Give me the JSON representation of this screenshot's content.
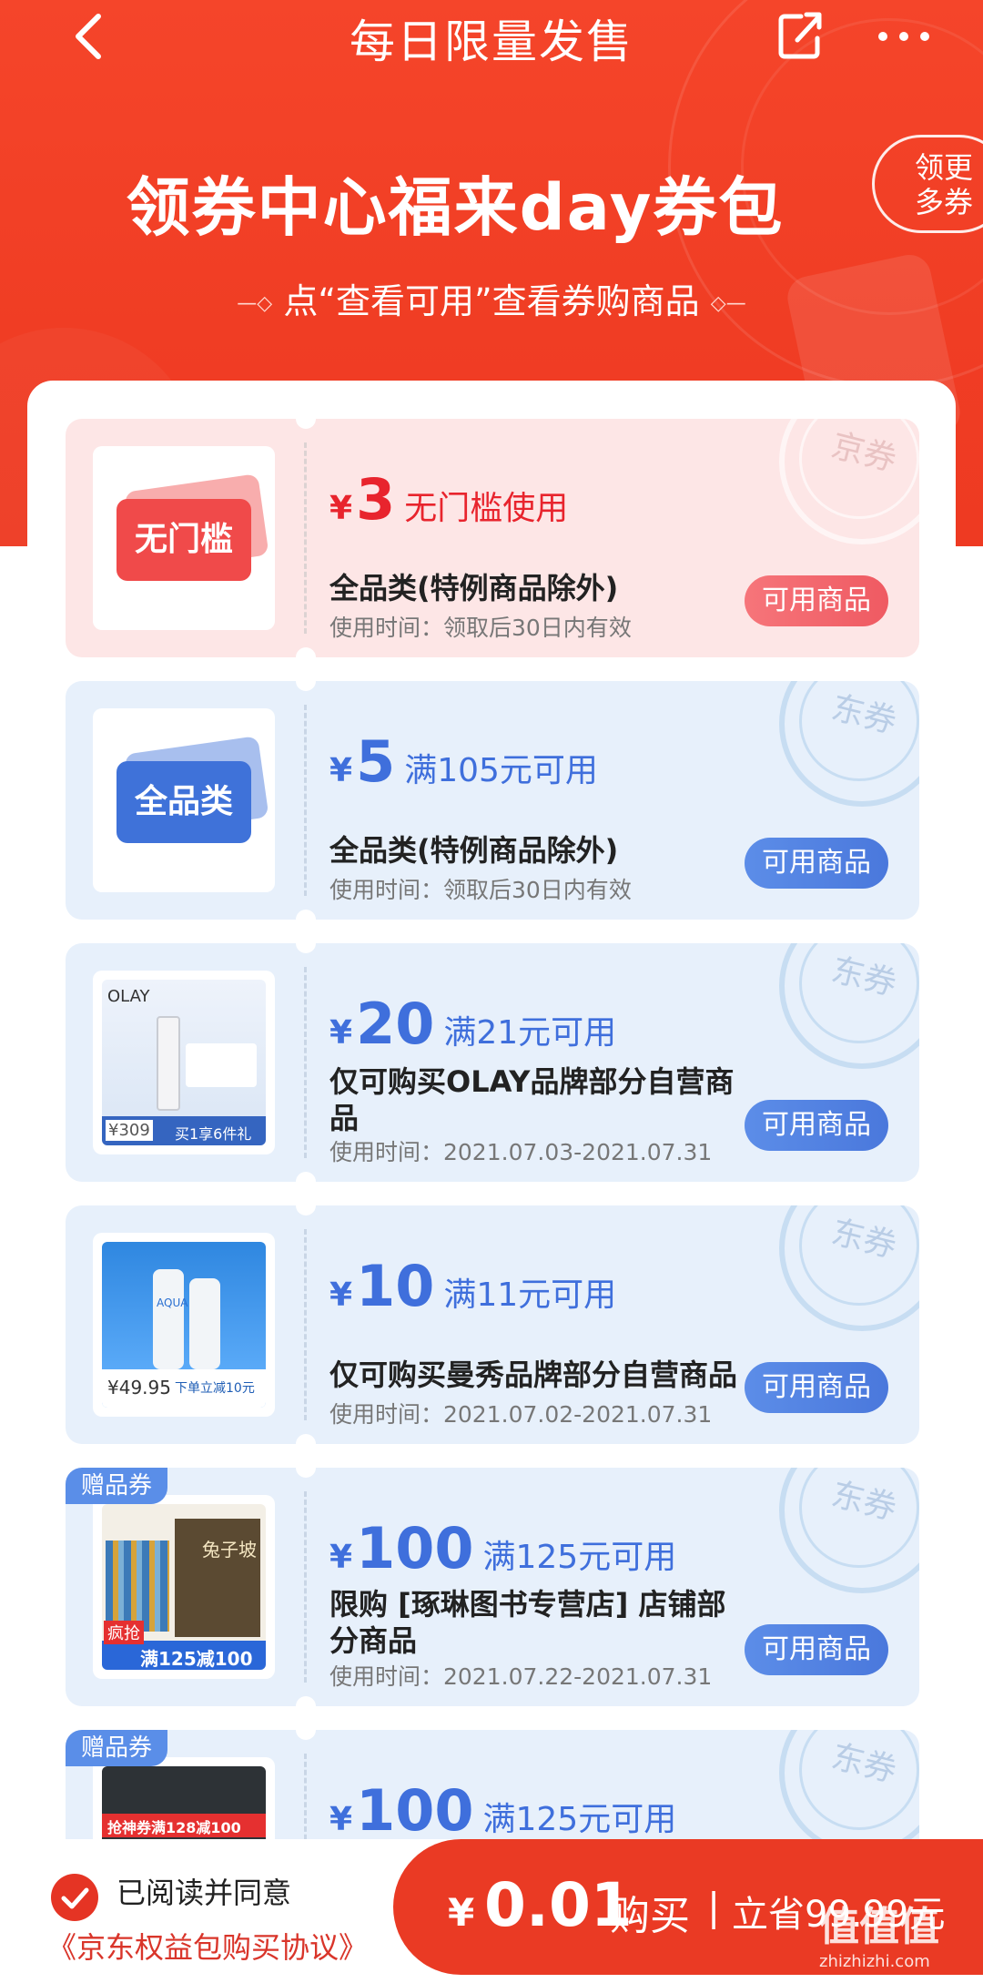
{
  "nav": {
    "title": "每日限量发售"
  },
  "hero": {
    "title": "领券中心福来day券包",
    "hint": "点“查看可用”查看券购商品",
    "more_line1": "领更",
    "more_line2": "多券"
  },
  "coupons": [
    {
      "style": "red",
      "image_label": "无门槛",
      "stamp": "京券",
      "yen": "¥",
      "amount": "3",
      "condition": "无门槛使用",
      "name": "全品类(特例商品除外)",
      "time": "使用时间：领取后30日内有效",
      "button": "可用商品"
    },
    {
      "style": "blue",
      "image_label": "全品类",
      "stamp": "东券",
      "yen": "¥",
      "amount": "5",
      "condition": "满105元可用",
      "name": "全品类(特例商品除外)",
      "time": "使用时间：领取后30日内有效",
      "button": "可用商品"
    },
    {
      "style": "blue",
      "image_label": "OLAY",
      "image_price": "¥309",
      "image_promo": "买1享6件礼",
      "stamp": "东券",
      "yen": "¥",
      "amount": "20",
      "condition": "满21元可用",
      "name": "仅可购买OLAY品牌部分自营商品",
      "time": "使用时间：2021.07.03-2021.07.31",
      "button": "可用商品"
    },
    {
      "style": "blue",
      "image_label": "AQUA",
      "image_price": "¥49.95",
      "image_promo": "下单立减10元",
      "stamp": "东券",
      "yen": "¥",
      "amount": "10",
      "condition": "满11元可用",
      "name": "仅可购买曼秀品牌部分自营商品",
      "time": "使用时间：2021.07.02-2021.07.31",
      "button": "可用商品"
    },
    {
      "style": "blue",
      "tag": "赠品券",
      "image_label": "兔子坡",
      "image_promo": "满125减100",
      "image_badge": "疯抢",
      "stamp": "东券",
      "yen": "¥",
      "amount": "100",
      "condition": "满125元可用",
      "name": "限购 [琢琳图书专营店] 店铺部分商品",
      "time": "使用时间：2021.07.22-2021.07.31",
      "button": "可用商品"
    },
    {
      "style": "blue",
      "tag": "赠品券",
      "image_promo": "抢神券满128减100",
      "stamp": "东券",
      "yen": "¥",
      "amount": "100",
      "condition": "满125元可用"
    }
  ],
  "bottom": {
    "agree_text": "已阅读并同意",
    "agreement_link": "《京东权益包购买协议》",
    "buy_yen": "¥",
    "buy_price": "0.01",
    "buy_word": "购买",
    "separator": "|",
    "save_text": "立省99.99元"
  },
  "watermark": {
    "big": "值值值",
    "small": "zhizhizhi.com"
  },
  "colors": {
    "brand_red": "#ea3a24",
    "coupon_red": "#e8242d",
    "coupon_blue": "#3f6fdc"
  }
}
